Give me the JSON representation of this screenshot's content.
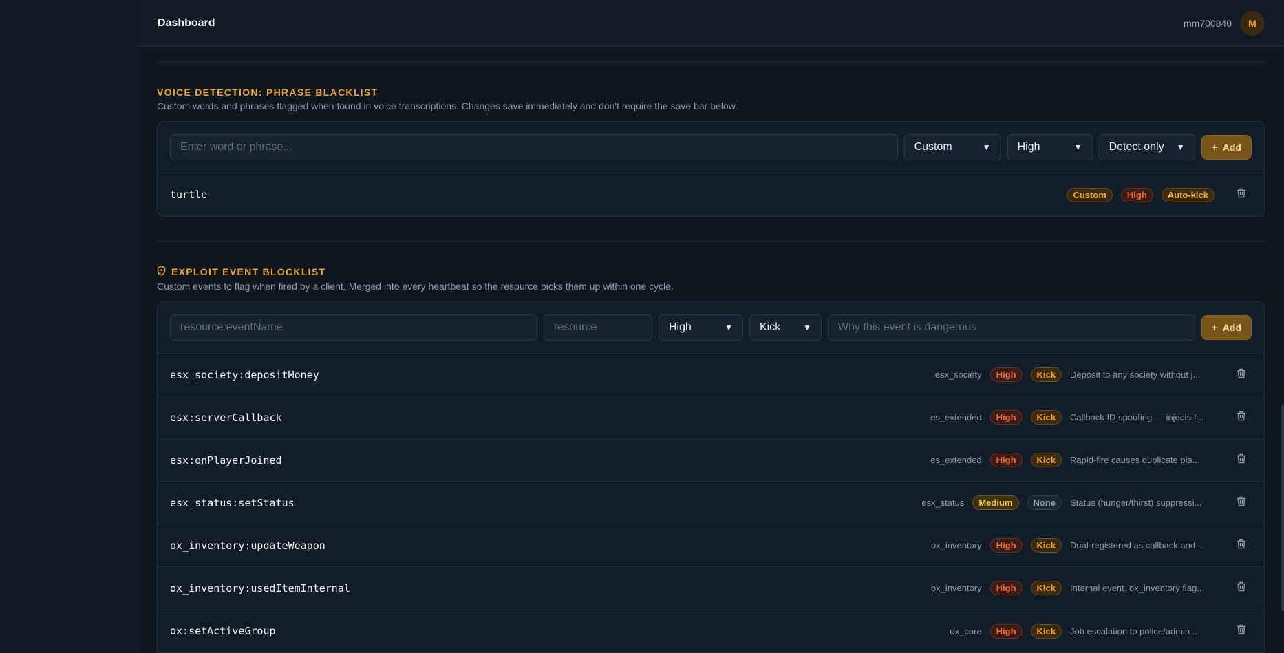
{
  "header": {
    "title": "Dashboard",
    "username": "mm700840",
    "avatar_letter": "M"
  },
  "phrase_section": {
    "title": "VOICE DETECTION: PHRASE BLACKLIST",
    "description": "Custom words and phrases flagged when found in voice transcriptions. Changes save immediately and don't require the save bar below.",
    "input_placeholder": "Enter word or phrase...",
    "category_select": "Custom",
    "severity_select": "High",
    "action_select": "Detect only",
    "add_label": "Add",
    "items": [
      {
        "phrase": "turtle",
        "category": "Custom",
        "severity": "High",
        "action": "Auto-kick"
      }
    ]
  },
  "exploit_section": {
    "title": "EXPLOIT EVENT BLOCKLIST",
    "description": "Custom events to flag when fired by a client. Merged into every heartbeat so the resource picks them up within one cycle.",
    "event_placeholder": "resource:eventName",
    "resource_placeholder": "resource",
    "severity_select": "High",
    "action_select": "Kick",
    "reason_placeholder": "Why this event is dangerous",
    "add_label": "Add",
    "items": [
      {
        "event": "esx_society:depositMoney",
        "resource": "esx_society",
        "severity": "High",
        "action": "Kick",
        "reason": "Deposit to any society without j..."
      },
      {
        "event": "esx:serverCallback",
        "resource": "es_extended",
        "severity": "High",
        "action": "Kick",
        "reason": "Callback ID spoofing — injects f..."
      },
      {
        "event": "esx:onPlayerJoined",
        "resource": "es_extended",
        "severity": "High",
        "action": "Kick",
        "reason": "Rapid-fire causes duplicate pla..."
      },
      {
        "event": "esx_status:setStatus",
        "resource": "esx_status",
        "severity": "Medium",
        "action": "None",
        "reason": "Status (hunger/thirst) suppressi..."
      },
      {
        "event": "ox_inventory:updateWeapon",
        "resource": "ox_inventory",
        "severity": "High",
        "action": "Kick",
        "reason": "Dual-registered as callback and..."
      },
      {
        "event": "ox_inventory:usedItemInternal",
        "resource": "ox_inventory",
        "severity": "High",
        "action": "Kick",
        "reason": "Internal event. ox_inventory flag..."
      },
      {
        "event": "ox:setActiveGroup",
        "resource": "ox_core",
        "severity": "High",
        "action": "Kick",
        "reason": "Job escalation to police/admin ..."
      }
    ]
  }
}
